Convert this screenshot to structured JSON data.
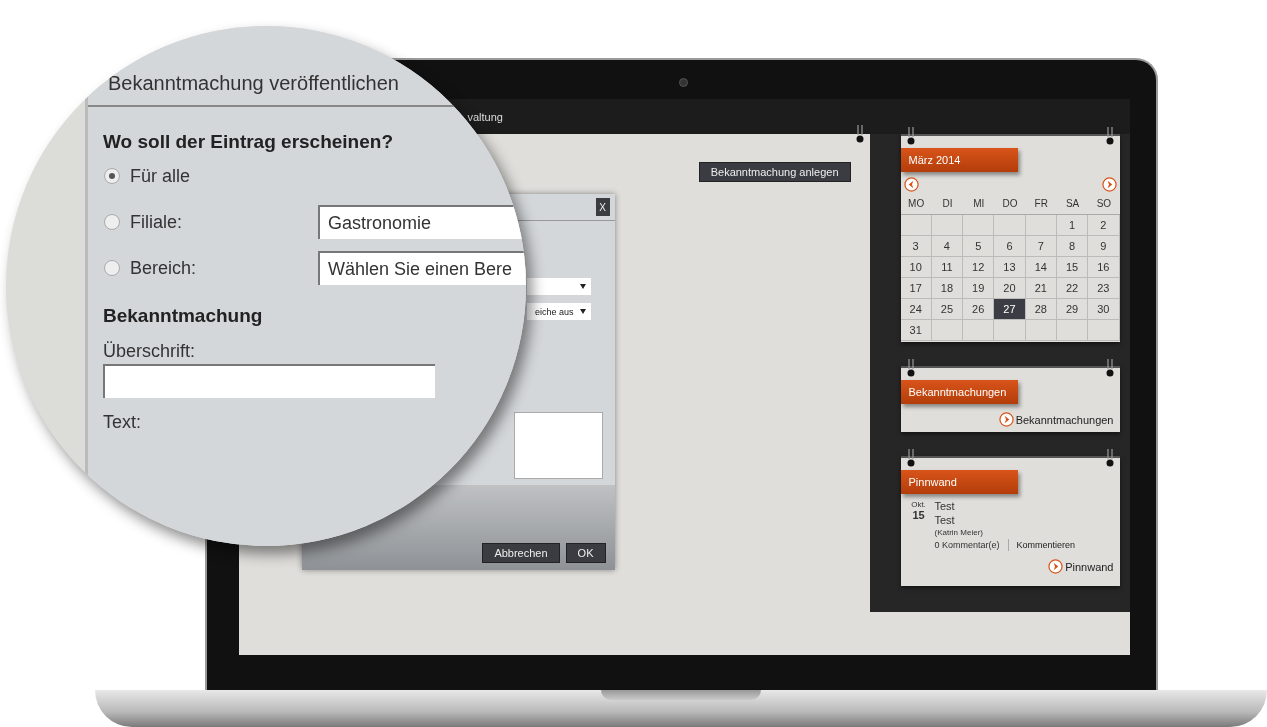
{
  "screen": {
    "nav": {
      "item": "valtung"
    },
    "main": {
      "create_button": "Bekanntmachung anlegen"
    },
    "dialog": {
      "close": "X",
      "selects": [
        {
          "kind": "empty"
        },
        {
          "kind": "text",
          "value": "eiche aus"
        }
      ],
      "buttons": [
        "Abbrechen",
        "OK"
      ]
    },
    "calendar": {
      "title": "März 2014",
      "weekdays": [
        "MO",
        "DI",
        "MI",
        "DO",
        "FR",
        "SA",
        "SO"
      ],
      "weeks": [
        [
          {
            "kind": "blank"
          },
          {
            "kind": "blank"
          },
          {
            "kind": "blank"
          },
          {
            "kind": "blank"
          },
          {
            "kind": "blank"
          },
          {
            "day": "1",
            "selected": false
          },
          {
            "day": "2",
            "selected": false
          }
        ],
        [
          {
            "day": "3",
            "selected": false
          },
          {
            "day": "4",
            "selected": false
          },
          {
            "day": "5",
            "selected": false
          },
          {
            "day": "6",
            "selected": false
          },
          {
            "day": "7",
            "selected": false
          },
          {
            "day": "8",
            "selected": false
          },
          {
            "day": "9",
            "selected": false
          }
        ],
        [
          {
            "day": "10",
            "selected": false
          },
          {
            "day": "11",
            "selected": false
          },
          {
            "day": "12",
            "selected": false
          },
          {
            "day": "13",
            "selected": false
          },
          {
            "day": "14",
            "selected": false
          },
          {
            "day": "15",
            "selected": false
          },
          {
            "day": "16",
            "selected": false
          }
        ],
        [
          {
            "day": "17",
            "selected": false
          },
          {
            "day": "18",
            "selected": false
          },
          {
            "day": "19",
            "selected": false
          },
          {
            "day": "20",
            "selected": false
          },
          {
            "day": "21",
            "selected": false
          },
          {
            "day": "22",
            "selected": false
          },
          {
            "day": "23",
            "selected": false
          }
        ],
        [
          {
            "day": "24",
            "selected": false
          },
          {
            "day": "25",
            "selected": false
          },
          {
            "day": "26",
            "selected": false
          },
          {
            "day": "27",
            "selected": true
          },
          {
            "day": "28",
            "selected": false
          },
          {
            "day": "29",
            "selected": false
          },
          {
            "day": "30",
            "selected": false
          }
        ],
        [
          {
            "day": "31",
            "selected": false
          },
          {
            "kind": "blank"
          },
          {
            "kind": "blank"
          },
          {
            "kind": "blank"
          },
          {
            "kind": "blank"
          },
          {
            "kind": "blank"
          },
          {
            "kind": "blank"
          }
        ]
      ]
    },
    "announcements": {
      "title": "Bekanntmachungen",
      "link": "Bekanntmachungen"
    },
    "pinboard": {
      "title": "Pinnwand",
      "entry": {
        "month": "Okt.",
        "day": "15",
        "title": "Test",
        "text": "Test",
        "author": "(Katrin Meier)",
        "comments": "0 Kommentar(e)",
        "comment_link": "Kommentieren"
      },
      "link": "Pinnwand"
    }
  },
  "magnifier": {
    "title": "Bekanntmachung veröffentlichen",
    "question": "Wo soll der Eintrag erscheinen?",
    "options": [
      {
        "label": "Für alle",
        "selected": true
      },
      {
        "label": "Filiale:",
        "selected": false,
        "value": "Gastronomie"
      },
      {
        "label": "Bereich:",
        "selected": false,
        "value": "Wählen Sie einen Bere"
      }
    ],
    "section": "Bekanntmachung",
    "heading_label": "Überschrift:",
    "text_label": "Text:"
  }
}
